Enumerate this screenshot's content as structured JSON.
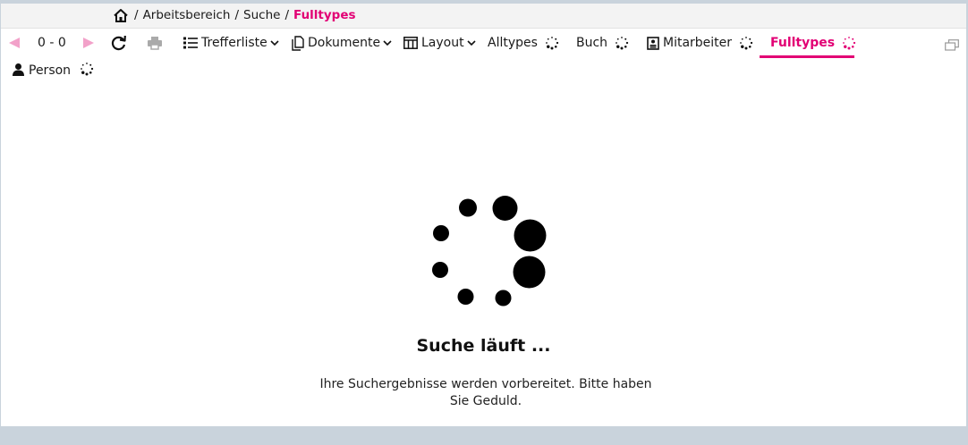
{
  "breadcrumb": {
    "separator": "/",
    "items": [
      "Arbeitsbereich",
      "Suche"
    ],
    "current": "Fulltypes"
  },
  "toolbar": {
    "range": "0 - 0",
    "trefferliste": "Trefferliste",
    "dokumente": "Dokumente",
    "layout": "Layout",
    "tabs": [
      {
        "label": "Alltypes",
        "icon": "none"
      },
      {
        "label": "Buch",
        "icon": "none"
      },
      {
        "label": "Mitarbeiter",
        "icon": "id-card-icon"
      },
      {
        "label": "Fulltypes",
        "icon": "none",
        "active": true
      },
      {
        "label": "Person",
        "icon": "person-icon"
      }
    ]
  },
  "status": {
    "title": "Suche läuft ...",
    "message": "Ihre Suchergebnisse werden vorbereitet. Bitte haben Sie Geduld."
  },
  "colors": {
    "accent": "#e20074",
    "arrow_disabled": "#f2a1c9",
    "background": "#c9d3dc",
    "breadcrumb_bar": "#f3f3f3"
  }
}
